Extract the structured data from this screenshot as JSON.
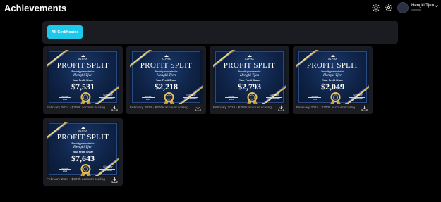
{
  "header": {
    "title": "Achievements",
    "user_name": "Hengki Tjen",
    "icons": [
      "sun-icon",
      "gear-icon",
      "chevron-down-icon"
    ]
  },
  "filters": {
    "all_label": "All Certificates"
  },
  "certificate_text": {
    "logo": "ALPHA",
    "logo_sub": "CAPITAL GROUP",
    "title": "PROFIT SPLIT",
    "presented": "Proudly presented to",
    "recipient": "Hengki Tjen",
    "share_label": "Your Profit Share",
    "date": "06 Feb 2024",
    "date_label": "Date",
    "signature": "George Hilton",
    "signature_role": "Managing Director"
  },
  "certificates": [
    {
      "amount": "$7,531",
      "caption": "February 2024 - $300k account scaling"
    },
    {
      "amount": "$2,218",
      "caption": "February 2024 - $300k account scaling"
    },
    {
      "amount": "$2,793",
      "caption": "February 2024 - $300k account scaling"
    },
    {
      "amount": "$2,049",
      "caption": "February 2024 - $300k account scaling"
    },
    {
      "amount": "$7,643",
      "caption": "February 2024 - $300k account scaling"
    }
  ],
  "colors": {
    "accent": "#1ec8ea",
    "panel": "#1b1c21",
    "cert_blue": "#0f2448",
    "gold": "#e8c25a"
  }
}
